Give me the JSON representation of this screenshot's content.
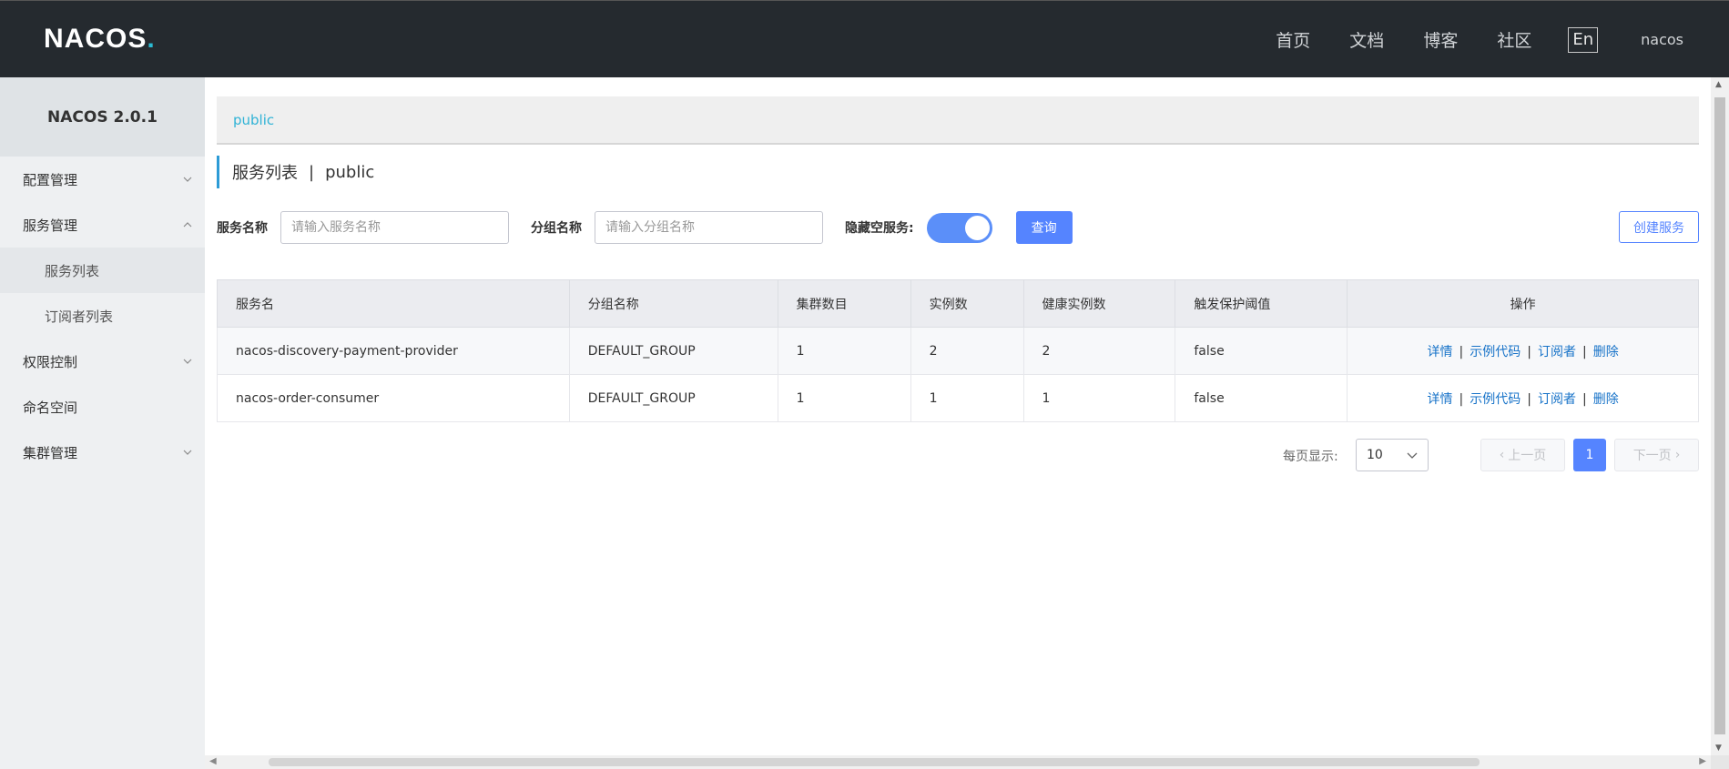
{
  "brand": {
    "logo_text": "NACOS",
    "logo_dot": "."
  },
  "topnav": {
    "links": [
      "首页",
      "文档",
      "博客",
      "社区"
    ],
    "lang": "En",
    "user": "nacos"
  },
  "sidebar": {
    "title": "NACOS 2.0.1",
    "items": [
      {
        "label": "配置管理",
        "expandable": true,
        "expanded": false
      },
      {
        "label": "服务管理",
        "expandable": true,
        "expanded": true,
        "children": [
          {
            "label": "服务列表",
            "active": true
          },
          {
            "label": "订阅者列表",
            "active": false
          }
        ]
      },
      {
        "label": "权限控制",
        "expandable": true,
        "expanded": false
      },
      {
        "label": "命名空间",
        "expandable": false
      },
      {
        "label": "集群管理",
        "expandable": true,
        "expanded": false
      }
    ]
  },
  "namespace": {
    "current": "public"
  },
  "page": {
    "title": "服务列表",
    "separator": "|",
    "namespace": "public"
  },
  "filter": {
    "service_label": "服务名称",
    "service_placeholder": "请输入服务名称",
    "group_label": "分组名称",
    "group_placeholder": "请输入分组名称",
    "hide_empty_label": "隐藏空服务:",
    "hide_empty_on": true,
    "query_button": "查询",
    "create_button": "创建服务"
  },
  "table": {
    "headers": [
      "服务名",
      "分组名称",
      "集群数目",
      "实例数",
      "健康实例数",
      "触发保护阈值",
      "操作"
    ],
    "rows": [
      {
        "name": "nacos-discovery-payment-provider",
        "group": "DEFAULT_GROUP",
        "clusters": "1",
        "instances": "2",
        "healthy": "2",
        "threshold": "false"
      },
      {
        "name": "nacos-order-consumer",
        "group": "DEFAULT_GROUP",
        "clusters": "1",
        "instances": "1",
        "healthy": "1",
        "threshold": "false"
      }
    ],
    "actions": [
      "详情",
      "示例代码",
      "订阅者",
      "删除"
    ],
    "action_sep": "|"
  },
  "pagination": {
    "page_size_label": "每页显示:",
    "page_size": "10",
    "prev": "上一页",
    "next": "下一页",
    "current_page": "1"
  },
  "colors": {
    "topbar": "#252a2f",
    "primary": "#5584ff",
    "link": "#1672c8",
    "accent": "#30b3d6"
  }
}
